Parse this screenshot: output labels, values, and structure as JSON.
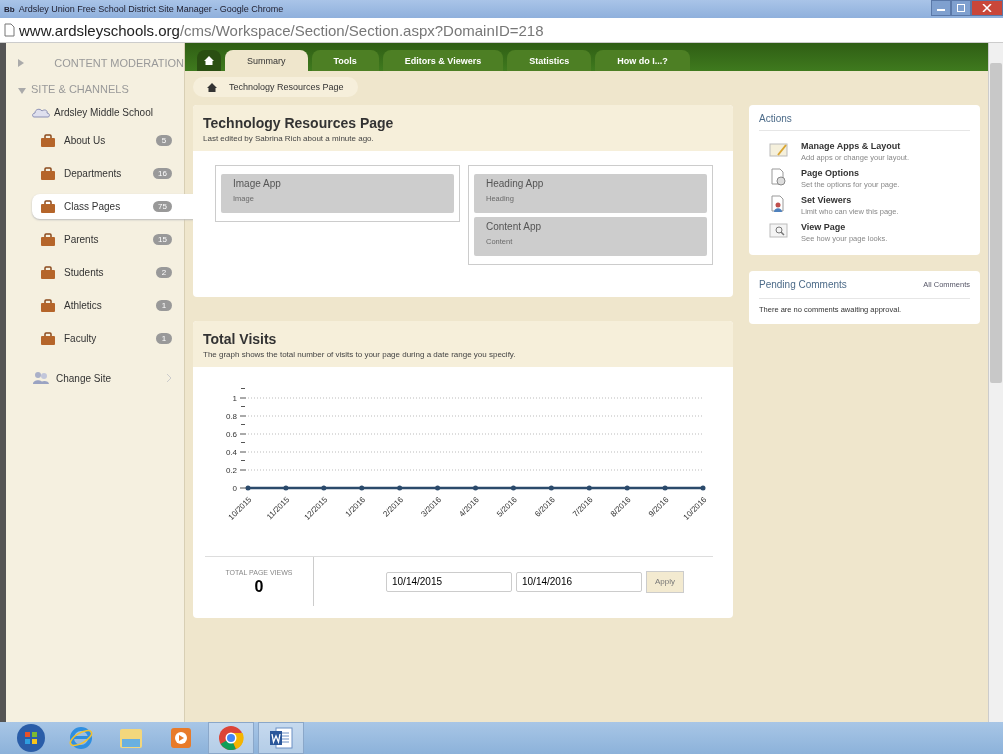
{
  "window": {
    "favicon": "Bb",
    "title": "Ardsley Union Free School District Site Manager - Google Chrome"
  },
  "address_bar": {
    "host": "www.ardsleyschools.org",
    "path": "/cms/Workspace/Section/Section.aspx?DomainID=218"
  },
  "sidebar": {
    "sections": [
      {
        "label": "CONTENT MODERATION",
        "expanded": false
      },
      {
        "label": "SITE & CHANNELS",
        "expanded": true
      }
    ],
    "site": "Ardsley Middle School",
    "items": [
      {
        "label": "About Us",
        "count": "5",
        "selected": false
      },
      {
        "label": "Departments",
        "count": "16",
        "selected": false
      },
      {
        "label": "Class Pages",
        "count": "75",
        "selected": true
      },
      {
        "label": "Parents",
        "count": "15",
        "selected": false
      },
      {
        "label": "Students",
        "count": "2",
        "selected": false
      },
      {
        "label": "Athletics",
        "count": "1",
        "selected": false
      },
      {
        "label": "Faculty",
        "count": "1",
        "selected": false
      }
    ],
    "change_site": "Change Site"
  },
  "tabs": [
    {
      "kind": "home",
      "selected": false
    },
    {
      "kind": "text",
      "label": "Summary",
      "selected": true
    },
    {
      "kind": "text",
      "label": "Tools",
      "selected": false
    },
    {
      "kind": "text",
      "label": "Editors & Viewers",
      "selected": false
    },
    {
      "kind": "text",
      "label": "Statistics",
      "selected": false
    },
    {
      "kind": "text",
      "label": "How do I...?",
      "selected": false
    }
  ],
  "breadcrumb": "Technology Resources Page",
  "page": {
    "title": "Technology Resources Page",
    "subtitle": "Last edited by Sabrina Rich about a minute ago.",
    "columns": [
      [
        {
          "title": "Image App",
          "type": "Image"
        }
      ],
      [
        {
          "title": "Heading App",
          "type": "Heading"
        },
        {
          "title": "Content App",
          "type": "Content"
        }
      ]
    ]
  },
  "visits": {
    "title": "Total Visits",
    "subtitle": "The graph shows the total number of visits to your page during a date range you specify.",
    "chart_data": {
      "type": "line",
      "categories": [
        "10/2015",
        "11/2015",
        "12/2015",
        "1/2016",
        "2/2016",
        "3/2016",
        "4/2016",
        "5/2016",
        "6/2016",
        "7/2016",
        "8/2016",
        "9/2016",
        "10/2016"
      ],
      "grid": true,
      "series": [
        {
          "color": "#2b4a6b",
          "values": [
            0,
            0,
            0,
            0,
            0,
            0,
            0,
            0,
            0,
            0,
            0,
            0,
            0
          ]
        }
      ],
      "ylim": [
        0,
        1
      ],
      "yticks": [
        0,
        0.2,
        0.4,
        0.6,
        0.8,
        1
      ]
    },
    "total_label": "TOTAL PAGE VIEWS",
    "total": "0",
    "start_date": "10/14/2015",
    "end_date": "10/14/2016",
    "apply": "Apply"
  },
  "actions": {
    "title": "Actions",
    "items": [
      {
        "kind": "layout",
        "title": "Manage Apps & Layout",
        "desc": "Add apps or change your layout."
      },
      {
        "kind": "options",
        "title": "Page Options",
        "desc": "Set the options for your page."
      },
      {
        "kind": "viewers",
        "title": "Set Viewers",
        "desc": "Limit who can view this page."
      },
      {
        "kind": "view",
        "title": "View Page",
        "desc": "See how your page looks."
      }
    ]
  },
  "comments": {
    "title": "Pending Comments",
    "link": "All Comments",
    "message": "There are no comments awaiting approval."
  },
  "taskbar": [
    {
      "kind": "start",
      "selected": false
    },
    {
      "kind": "ie",
      "selected": false
    },
    {
      "kind": "explorer",
      "selected": false
    },
    {
      "kind": "media",
      "selected": false
    },
    {
      "kind": "chrome",
      "selected": true
    },
    {
      "kind": "word",
      "selected": true
    }
  ]
}
